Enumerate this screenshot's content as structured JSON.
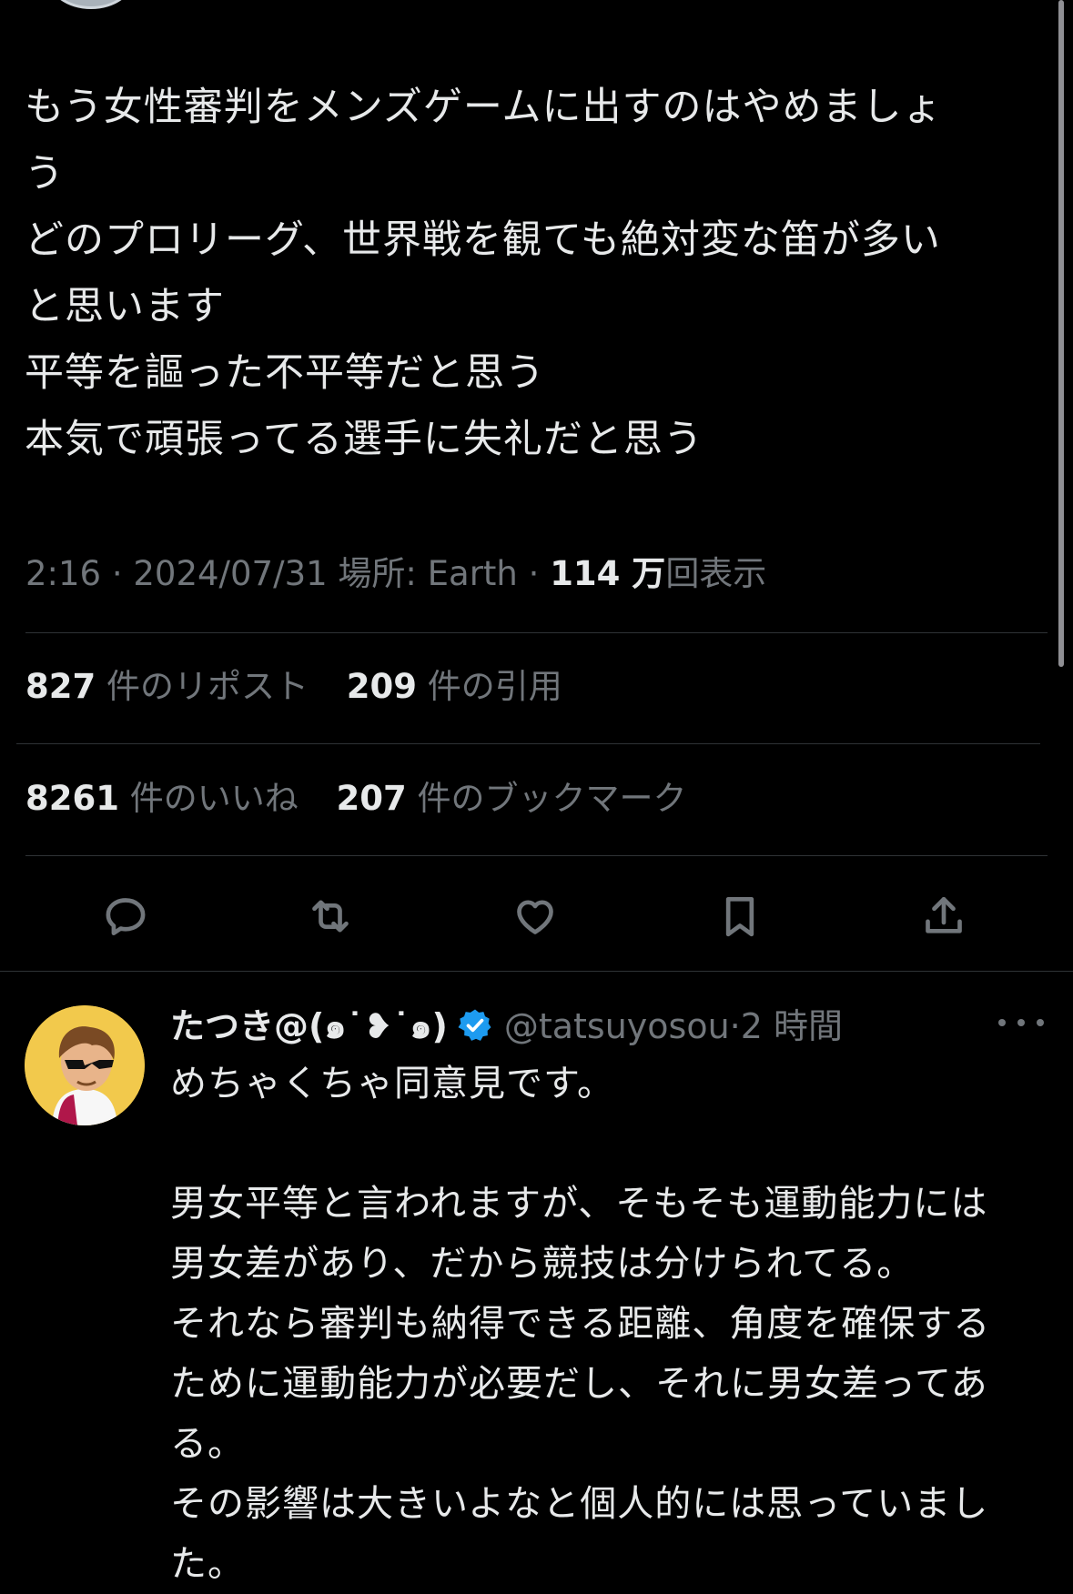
{
  "tweet": {
    "lines": [
      "もう女性審判をメンズゲームに出すのはやめましょ",
      "う",
      "どのプロリーグ、世界戦を観ても絶対変な笛が多い",
      "と思います",
      "平等を謳った不平等だと思う",
      "本気で頑張ってる選手に失礼だと思う"
    ],
    "time": "2:16",
    "separator": "·",
    "date": "2024/07/31",
    "location_label": "場所:",
    "location": "Earth",
    "views_num": "114 万",
    "views_label": "回表示"
  },
  "stats": {
    "reposts_num": "827",
    "reposts_label": "件のリポスト",
    "quotes_num": "209",
    "quotes_label": "件の引用",
    "likes_num": "8261",
    "likes_label": "件のいいね",
    "bookmarks_num": "207",
    "bookmarks_label": "件のブックマーク"
  },
  "actions": {
    "icons": [
      "reply-icon",
      "retweet-icon",
      "like-icon",
      "bookmark-icon",
      "share-icon"
    ],
    "icon_color": "#71767b"
  },
  "reply": {
    "name": "たつき@(๑˙❥˙๑)",
    "handle": "@tatsuyosou",
    "separator": "·",
    "time": "2 時間",
    "verified_color": "#1d9bf0",
    "lines": [
      "めちゃくちゃ同意見です。",
      "",
      "男女平等と言われますが、そもそも運動能力には",
      "男女差があり、だから競技は分けられてる。",
      "それなら審判も納得できる距離、角度を確保する",
      "ために運動能力が必要だし、それに男女差ってあ",
      "る。",
      "その影響は大きいよなと個人的には思っていまし",
      "た。"
    ]
  },
  "colors": {
    "background": "#000000",
    "primary_text": "#e7e9ea",
    "secondary_text": "#71767b",
    "divider": "#2f3336"
  }
}
